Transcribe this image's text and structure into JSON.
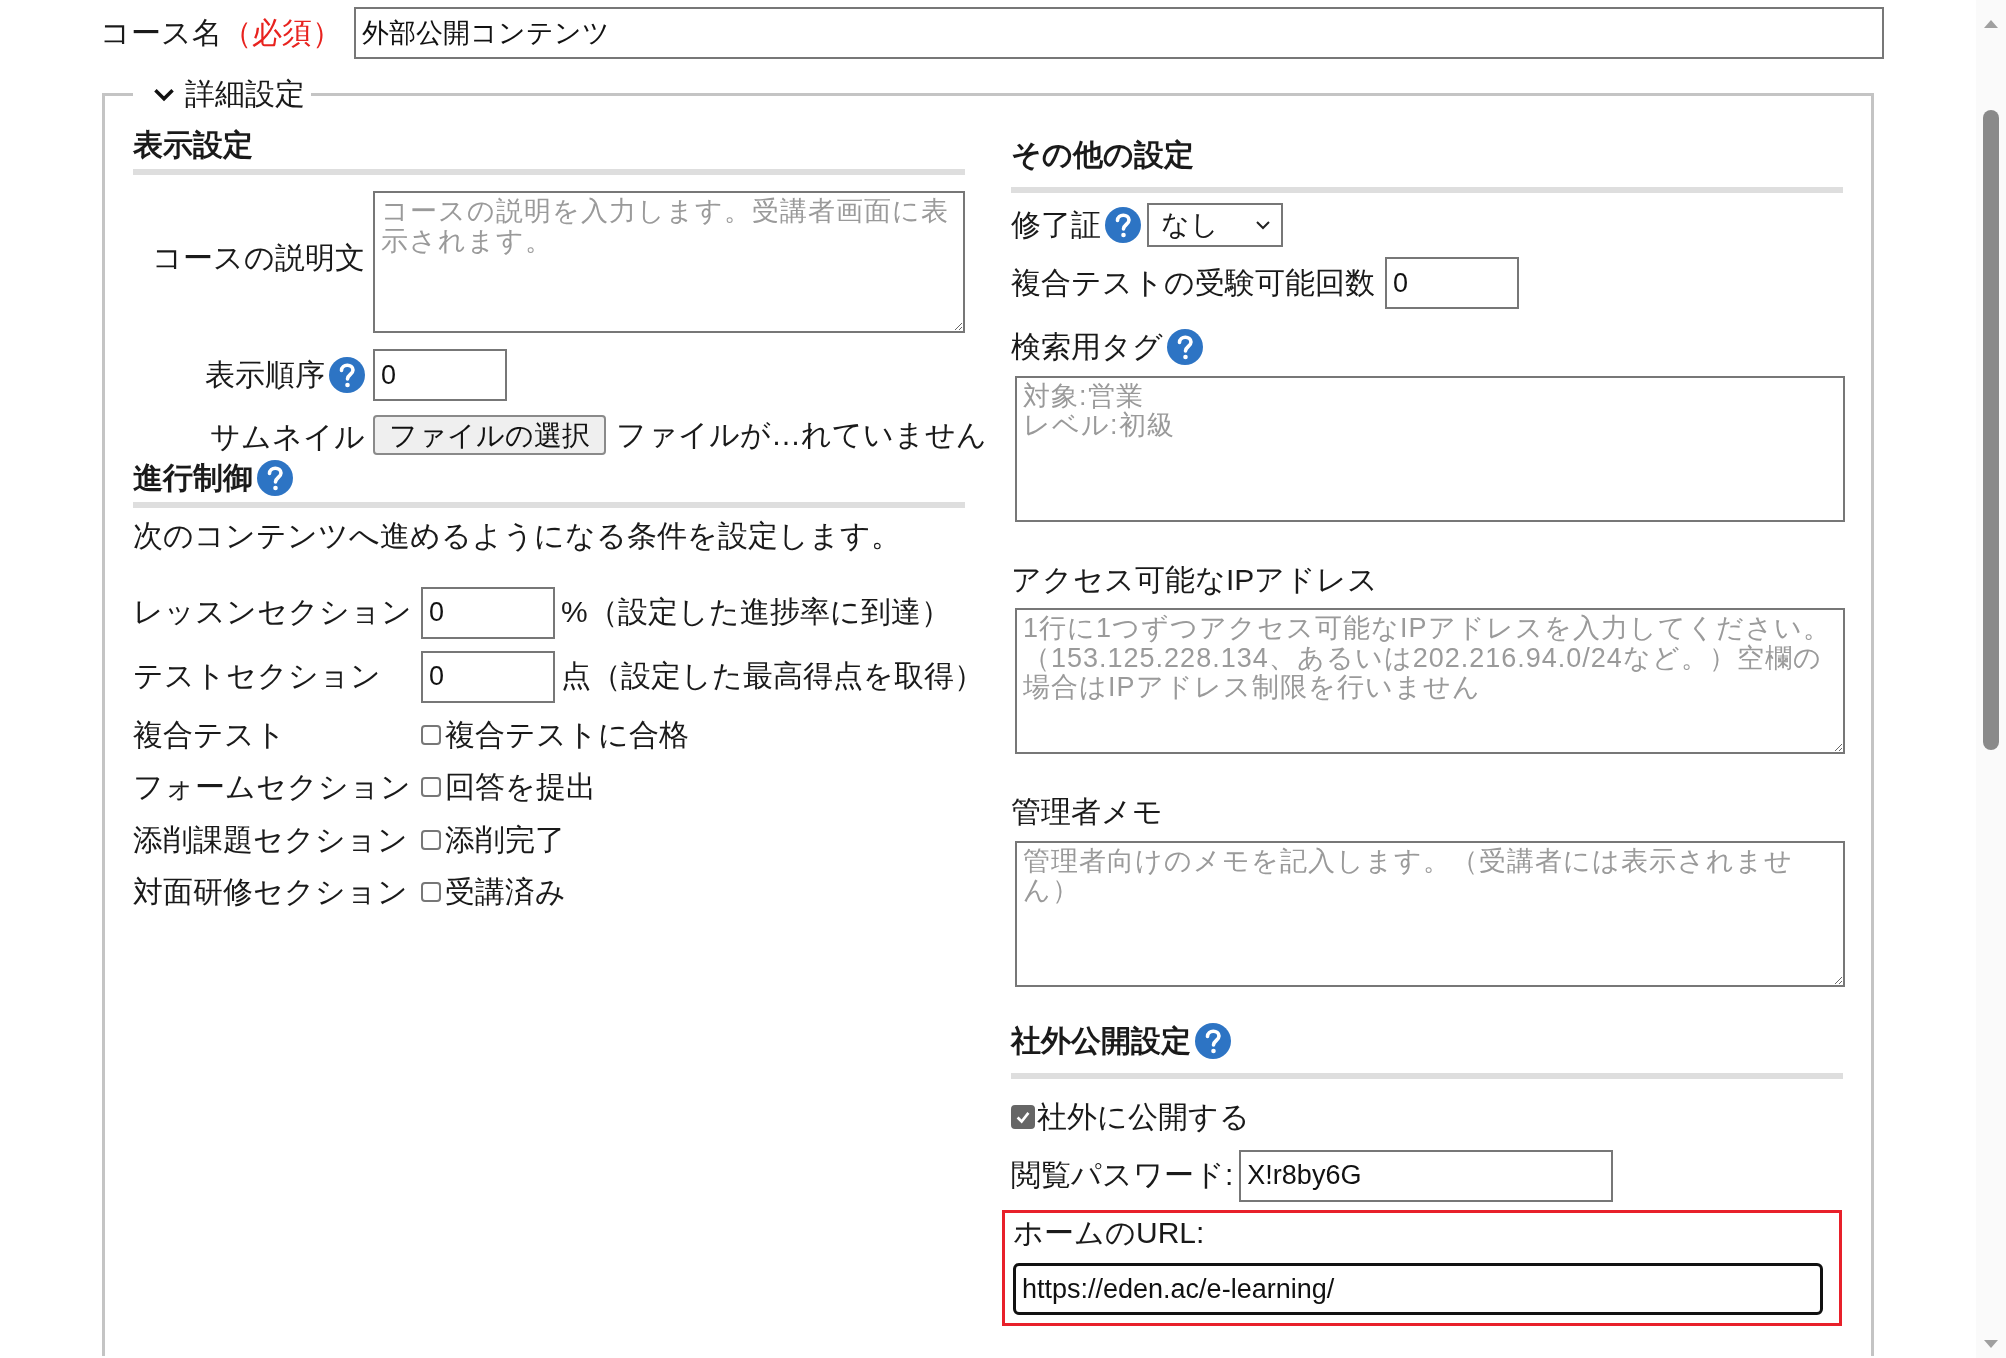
{
  "course_name": {
    "label": "コース名",
    "required": "（必須）",
    "value": "外部公開コンテンツ"
  },
  "details": {
    "title": "詳細設定",
    "expanded": true,
    "display_settings": {
      "heading": "表示設定",
      "description": {
        "label": "コースの説明文",
        "placeholder": "コースの説明を入力します。受講者画面に表示されます。"
      },
      "display_order": {
        "label": "表示順序",
        "help": true,
        "value": "0"
      },
      "thumbnail": {
        "label": "サムネイル",
        "button": "ファイルの選択",
        "status": "ファイルが…れていません"
      }
    },
    "progress_control": {
      "heading": "進行制御",
      "help": true,
      "intro": "次のコンテンツへ進めるようになる条件を設定します。",
      "rows": [
        {
          "kind": "number",
          "label": "レッスンセクション",
          "value": "0",
          "note": "%（設定した進捗率に到達）"
        },
        {
          "kind": "number",
          "label": "テストセクション",
          "value": "0",
          "note": "点（設定した最高得点を取得）"
        },
        {
          "kind": "checkbox",
          "label": "複合テスト",
          "option": "複合テストに合格",
          "checked": false
        },
        {
          "kind": "checkbox",
          "label": "フォームセクション",
          "option": "回答を提出",
          "checked": false
        },
        {
          "kind": "checkbox",
          "label": "添削課題セクション",
          "option": "添削完了",
          "checked": false
        },
        {
          "kind": "checkbox",
          "label": "対面研修セクション",
          "option": "受講済み",
          "checked": false
        }
      ]
    },
    "other_settings": {
      "heading": "その他の設定",
      "certificate": {
        "label": "修了証",
        "help": true,
        "value": "なし"
      },
      "exam_attempts": {
        "label": "複合テストの受験可能回数",
        "value": "0"
      },
      "search_tags": {
        "label": "検索用タグ",
        "help": true,
        "placeholder": [
          "対象:営業",
          "レベル:初級"
        ]
      },
      "ip_addresses": {
        "label": "アクセス可能なIPアドレス",
        "placeholder": "1行に1つずつアクセス可能なIPアドレスを入力してください。（153.125.228.134、あるいは202.216.94.0/24など。）空欄の場合はIPアドレス制限を行いません"
      },
      "admin_memo": {
        "label": "管理者メモ",
        "placeholder": "管理者向けのメモを記入します。（受講者には表示されません）"
      }
    },
    "public_settings": {
      "heading": "社外公開設定",
      "help": true,
      "publish": {
        "label": "社外に公開する",
        "checked": true
      },
      "password": {
        "label": "閲覧パスワード:",
        "value": "X!r8by6G"
      },
      "home_url": {
        "label": "ホームのURL:",
        "value": "https://eden.ac/e-learning/",
        "highlighted": true
      }
    }
  }
}
